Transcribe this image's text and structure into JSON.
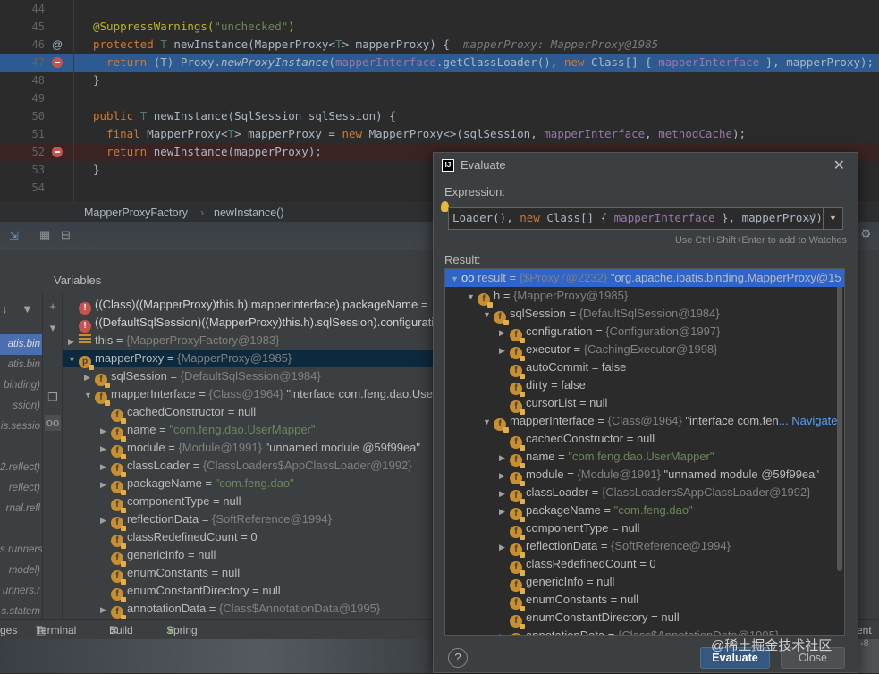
{
  "editor": {
    "lines": [
      {
        "num": "44",
        "parts": []
      },
      {
        "num": "45",
        "parts": [
          {
            "t": "@SuppressWarnings(",
            "c": "ann"
          },
          {
            "t": "\"unchecked\"",
            "c": "str"
          },
          {
            "t": ")",
            "c": "ann"
          }
        ]
      },
      {
        "num": "46",
        "marker": "@",
        "parts": [
          {
            "t": "protected ",
            "c": "kw"
          },
          {
            "t": "T ",
            "c": "typ"
          },
          {
            "t": "newInstance",
            "c": ""
          },
          {
            "t": "(MapperProxy<",
            "c": ""
          },
          {
            "t": "T",
            "c": "typ"
          },
          {
            "t": "> mapperProxy) {  ",
            "c": ""
          },
          {
            "t": "mapperProxy: MapperProxy@1985",
            "c": "hint"
          }
        ]
      },
      {
        "num": "47",
        "bp": true,
        "hl": true,
        "parts": [
          {
            "t": "  return ",
            "c": "kw"
          },
          {
            "t": "(T) Proxy.",
            "c": ""
          },
          {
            "t": "newProxyInstance",
            "c": "it"
          },
          {
            "t": "(",
            "c": ""
          },
          {
            "t": "mapperInterface",
            "c": "fld"
          },
          {
            "t": ".getClassLoader(), ",
            "c": ""
          },
          {
            "t": "new ",
            "c": "kw"
          },
          {
            "t": "Class[] { ",
            "c": ""
          },
          {
            "t": "mapperInterface",
            "c": "fld"
          },
          {
            "t": " }, mapperProxy);  ",
            "c": ""
          },
          {
            "t": "mapp",
            "c": "hint"
          }
        ]
      },
      {
        "num": "48",
        "parts": [
          {
            "t": "}",
            "c": ""
          }
        ]
      },
      {
        "num": "49",
        "parts": []
      },
      {
        "num": "50",
        "parts": [
          {
            "t": "public ",
            "c": "kw"
          },
          {
            "t": "T ",
            "c": "typ"
          },
          {
            "t": "newInstance(SqlSession sqlSession) {",
            "c": ""
          }
        ]
      },
      {
        "num": "51",
        "parts": [
          {
            "t": "  final ",
            "c": "kw"
          },
          {
            "t": "MapperProxy<",
            "c": ""
          },
          {
            "t": "T",
            "c": "typ"
          },
          {
            "t": "> mapperProxy = ",
            "c": ""
          },
          {
            "t": "new ",
            "c": "kw"
          },
          {
            "t": "MapperProxy<>(sqlSession, ",
            "c": ""
          },
          {
            "t": "mapperInterface",
            "c": "fld"
          },
          {
            "t": ", ",
            "c": ""
          },
          {
            "t": "methodCache",
            "c": "fld"
          },
          {
            "t": ");",
            "c": ""
          }
        ]
      },
      {
        "num": "52",
        "bp": true,
        "red": true,
        "parts": [
          {
            "t": "  return ",
            "c": "kw"
          },
          {
            "t": "newInstance(mapperProxy);",
            "c": ""
          }
        ]
      },
      {
        "num": "53",
        "parts": [
          {
            "t": "}",
            "c": ""
          }
        ]
      },
      {
        "num": "54",
        "parts": []
      }
    ]
  },
  "breadcrumb": {
    "class": "MapperProxyFactory",
    "sep": "›",
    "method": "newInstance()"
  },
  "variables": {
    "label": "Variables"
  },
  "left_frames": [
    "",
    "",
    "atis.bin",
    "atis.bin",
    "binding)",
    "ssion)",
    "is.sessio",
    "",
    "2.reflect)",
    "reflect)",
    "rnal.refl",
    "",
    "s.runners",
    "model)",
    "unners.r",
    "s.statem",
    "",
    "rs)"
  ],
  "var_rows": [
    {
      "indent": 0,
      "icon": "ex",
      "tri": "",
      "name": "((Class)((MapperProxy)this.h).mapperInterface).packageName",
      "val": " = "
    },
    {
      "indent": 0,
      "icon": "ex",
      "tri": "",
      "name": "((DefaultSqlSession)((MapperProxy)this.h).sqlSession).configurati",
      "val": ""
    },
    {
      "indent": 0,
      "icon": "list",
      "tri": "▶",
      "name": "this",
      "val": " = ",
      "gray": "{MapperProxyFactory@1983}"
    },
    {
      "indent": 0,
      "icon": "p",
      "tri": "▼",
      "name": "mapperProxy",
      "val": " = ",
      "gray": "{MapperProxy@1985}",
      "sel": true
    },
    {
      "indent": 1,
      "icon": "f",
      "tri": "▶",
      "name": "sqlSession",
      "val": " = ",
      "gray": "{DefaultSqlSession@1984}"
    },
    {
      "indent": 1,
      "icon": "f",
      "tri": "▼",
      "name": "mapperInterface",
      "val": " = ",
      "gray": "{Class@1964}",
      "rest": " \"interface com.feng.dao.User"
    },
    {
      "indent": 2,
      "icon": "f",
      "tri": "",
      "name": "cachedConstructor",
      "val": " = null"
    },
    {
      "indent": 2,
      "icon": "f",
      "tri": "▶",
      "name": "name",
      "val": " = ",
      "str": "\"com.feng.dao.UserMapper\""
    },
    {
      "indent": 2,
      "icon": "f",
      "tri": "▶",
      "name": "module",
      "val": " = ",
      "gray": "{Module@1991}",
      "rest": " \"unnamed module @59f99ea\""
    },
    {
      "indent": 2,
      "icon": "f",
      "tri": "▶",
      "name": "classLoader",
      "val": " = ",
      "gray": "{ClassLoaders$AppClassLoader@1992}"
    },
    {
      "indent": 2,
      "icon": "f",
      "tri": "▶",
      "name": "packageName",
      "val": " = ",
      "str": "\"com.feng.dao\""
    },
    {
      "indent": 2,
      "icon": "f",
      "tri": "",
      "name": "componentType",
      "val": " = null"
    },
    {
      "indent": 2,
      "icon": "f",
      "tri": "▶",
      "name": "reflectionData",
      "val": " = ",
      "gray": "{SoftReference@1994}"
    },
    {
      "indent": 2,
      "icon": "f",
      "tri": "",
      "name": "classRedefinedCount",
      "val": " = 0"
    },
    {
      "indent": 2,
      "icon": "f",
      "tri": "",
      "name": "genericInfo",
      "val": " = null"
    },
    {
      "indent": 2,
      "icon": "f",
      "tri": "",
      "name": "enumConstants",
      "val": " = null"
    },
    {
      "indent": 2,
      "icon": "f",
      "tri": "",
      "name": "enumConstantDirectory",
      "val": " = null"
    },
    {
      "indent": 2,
      "icon": "f",
      "tri": "▶",
      "name": "annotationData",
      "val": " = ",
      "gray": "{Class$AnnotationData@1995}"
    }
  ],
  "bottom_tabs": [
    {
      "label": "ges"
    },
    {
      "label": "Terminal"
    },
    {
      "label": "Build"
    },
    {
      "label": "Spring"
    },
    {
      "label": "ent L"
    }
  ],
  "dialog": {
    "title": "Evaluate",
    "expression_label": "Expression:",
    "expression": [
      {
        "t": "Loader(), ",
        "c": ""
      },
      {
        "t": "new ",
        "c": "kw"
      },
      {
        "t": "Class[] { ",
        "c": ""
      },
      {
        "t": "mapperInterface",
        "c": "fld"
      },
      {
        "t": " }, mapperProxy)",
        "c": ""
      }
    ],
    "hint": "Use Ctrl+Shift+Enter to add to Watches",
    "result_label": "Result:",
    "evaluate": "Evaluate",
    "close": "Close",
    "help": "?"
  },
  "result_rows": [
    {
      "indent": 0,
      "icon": "oo",
      "tri": "▼",
      "name": "result",
      "val": " = ",
      "gray": "{$Proxy7@2232}",
      "rest": " \"org.apache.ibatis.binding.MapperProxy@15",
      "top": true
    },
    {
      "indent": 1,
      "icon": "f",
      "tri": "▼",
      "name": "h",
      "val": " = ",
      "gray": "{MapperProxy@1985}"
    },
    {
      "indent": 2,
      "icon": "f",
      "tri": "▼",
      "name": "sqlSession",
      "val": " = ",
      "gray": "{DefaultSqlSession@1984}"
    },
    {
      "indent": 3,
      "icon": "f",
      "tri": "▶",
      "name": "configuration",
      "val": " = ",
      "gray": "{Configuration@1997}"
    },
    {
      "indent": 3,
      "icon": "f",
      "tri": "▶",
      "name": "executor",
      "val": " = ",
      "gray": "{CachingExecutor@1998}"
    },
    {
      "indent": 3,
      "icon": "f",
      "tri": "",
      "name": "autoCommit",
      "val": " = false"
    },
    {
      "indent": 3,
      "icon": "f",
      "tri": "",
      "name": "dirty",
      "val": " = false"
    },
    {
      "indent": 3,
      "icon": "f",
      "tri": "",
      "name": "cursorList",
      "val": " = null"
    },
    {
      "indent": 2,
      "icon": "f",
      "tri": "▼",
      "name": "mapperInterface",
      "val": " = ",
      "gray": "{Class@1964}",
      "rest": " \"interface com.fen",
      "link": "... Navigate"
    },
    {
      "indent": 3,
      "icon": "f",
      "tri": "",
      "name": "cachedConstructor",
      "val": " = null"
    },
    {
      "indent": 3,
      "icon": "f",
      "tri": "▶",
      "name": "name",
      "val": " = ",
      "str": "\"com.feng.dao.UserMapper\""
    },
    {
      "indent": 3,
      "icon": "f",
      "tri": "▶",
      "name": "module",
      "val": " = ",
      "gray": "{Module@1991}",
      "rest": " \"unnamed module @59f99ea\""
    },
    {
      "indent": 3,
      "icon": "f",
      "tri": "▶",
      "name": "classLoader",
      "val": " = ",
      "gray": "{ClassLoaders$AppClassLoader@1992}"
    },
    {
      "indent": 3,
      "icon": "f",
      "tri": "▶",
      "name": "packageName",
      "val": " = ",
      "str": "\"com.feng.dao\""
    },
    {
      "indent": 3,
      "icon": "f",
      "tri": "",
      "name": "componentType",
      "val": " = null"
    },
    {
      "indent": 3,
      "icon": "f",
      "tri": "▶",
      "name": "reflectionData",
      "val": " = ",
      "gray": "{SoftReference@1994}"
    },
    {
      "indent": 3,
      "icon": "f",
      "tri": "",
      "name": "classRedefinedCount",
      "val": " = 0"
    },
    {
      "indent": 3,
      "icon": "f",
      "tri": "",
      "name": "genericInfo",
      "val": " = null"
    },
    {
      "indent": 3,
      "icon": "f",
      "tri": "",
      "name": "enumConstants",
      "val": " = null"
    },
    {
      "indent": 3,
      "icon": "f",
      "tri": "",
      "name": "enumConstantDirectory",
      "val": " = null"
    },
    {
      "indent": 3,
      "icon": "f",
      "tri": "▶",
      "name": "annotationData",
      "val": " = ",
      "gray": "{Class$AnnotationData@1995}"
    }
  ],
  "watermark": "@稀土掘金技术社区",
  "side_num": "-8"
}
